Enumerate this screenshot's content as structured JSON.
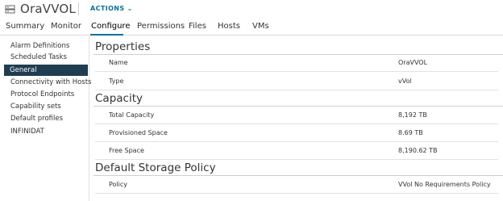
{
  "header": {
    "title": "OraVVOL",
    "actions_label": "ACTIONS"
  },
  "tabs": [
    {
      "label": "Summary"
    },
    {
      "label": "Monitor"
    },
    {
      "label": "Configure",
      "active": true
    },
    {
      "label": "Permissions"
    },
    {
      "label": "Files"
    },
    {
      "label": "Hosts"
    },
    {
      "label": "VMs"
    }
  ],
  "sidebar": {
    "items": [
      {
        "label": "Alarm Definitions"
      },
      {
        "label": "Scheduled Tasks"
      },
      {
        "label": "General",
        "selected": true
      },
      {
        "label": "Connectivity with Hosts"
      },
      {
        "label": "Protocol Endpoints"
      },
      {
        "label": "Capability sets"
      },
      {
        "label": "Default profiles"
      },
      {
        "label": "INFINIDAT"
      }
    ]
  },
  "sections": {
    "properties": {
      "title": "Properties",
      "rows": [
        {
          "key": "Name",
          "value": "OraVVOL"
        },
        {
          "key": "Type",
          "value": "vVol"
        }
      ]
    },
    "capacity": {
      "title": "Capacity",
      "rows": [
        {
          "key": "Total Capacity",
          "value": "8,192 TB"
        },
        {
          "key": "Provisioned Space",
          "value": "8.69 TB"
        },
        {
          "key": "Free Space",
          "value": "8,190.62 TB"
        }
      ]
    },
    "policy": {
      "title": "Default Storage Policy",
      "rows": [
        {
          "key": "Policy",
          "value": "VVol No Requirements Policy"
        }
      ]
    }
  },
  "colors": {
    "accent": "#0072a3",
    "sidebar_selected_bg": "#1e3d51"
  }
}
